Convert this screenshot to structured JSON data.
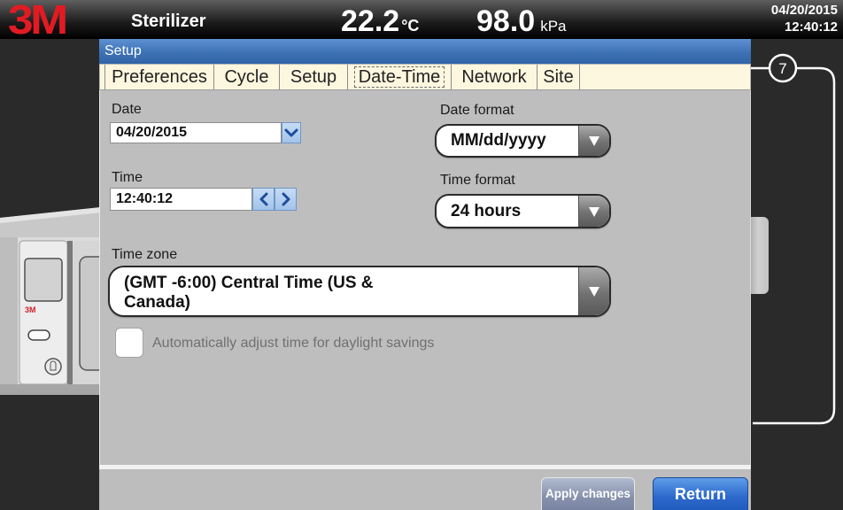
{
  "header": {
    "logo": "3M",
    "title": "Sterilizer",
    "temperature": {
      "value": "22.2",
      "unit": "°C"
    },
    "pressure": {
      "value": "98.0",
      "unit": "kPa"
    },
    "date": "04/20/2015",
    "time": "12:40:12"
  },
  "dialog": {
    "title": "Setup",
    "tabs": [
      {
        "label": "Preferences",
        "active": false
      },
      {
        "label": "Cycle",
        "active": false
      },
      {
        "label": "Setup",
        "active": false
      },
      {
        "label": "Date-Time",
        "active": true
      },
      {
        "label": "Network",
        "active": false
      },
      {
        "label": "Site",
        "active": false
      }
    ]
  },
  "form": {
    "date": {
      "label": "Date",
      "value": "04/20/2015"
    },
    "time": {
      "label": "Time",
      "value": "12:40:12"
    },
    "date_format": {
      "label": "Date format",
      "value": "MM/dd/yyyy"
    },
    "time_format": {
      "label": "Time format",
      "value": "24 hours"
    },
    "time_zone": {
      "label": "Time zone",
      "value": "(GMT -6:00) Central Time (US & Canada)"
    },
    "dst": {
      "label": "Automatically adjust time for daylight savings",
      "checked": false,
      "enabled": false
    }
  },
  "footer": {
    "apply_label": "Apply changes",
    "apply_enabled": false,
    "return_label": "Return"
  },
  "machine": {
    "logo": "3M"
  },
  "callout": {
    "label": "7"
  },
  "icons": {
    "date_picker": "chevron-down-icon",
    "time_decrement": "chevron-left-icon",
    "time_increment": "chevron-right-icon",
    "select_arrow": "triangle-down-icon"
  },
  "colors": {
    "logo_red": "#e21b23",
    "title_bar_blue": "#3d72b5",
    "tab_strip": "#fdf7df",
    "panel_bg": "#bebebe",
    "return_button": "#2d6acd",
    "apply_button": "#8792ad",
    "spin_button": "#a3c3ea"
  }
}
